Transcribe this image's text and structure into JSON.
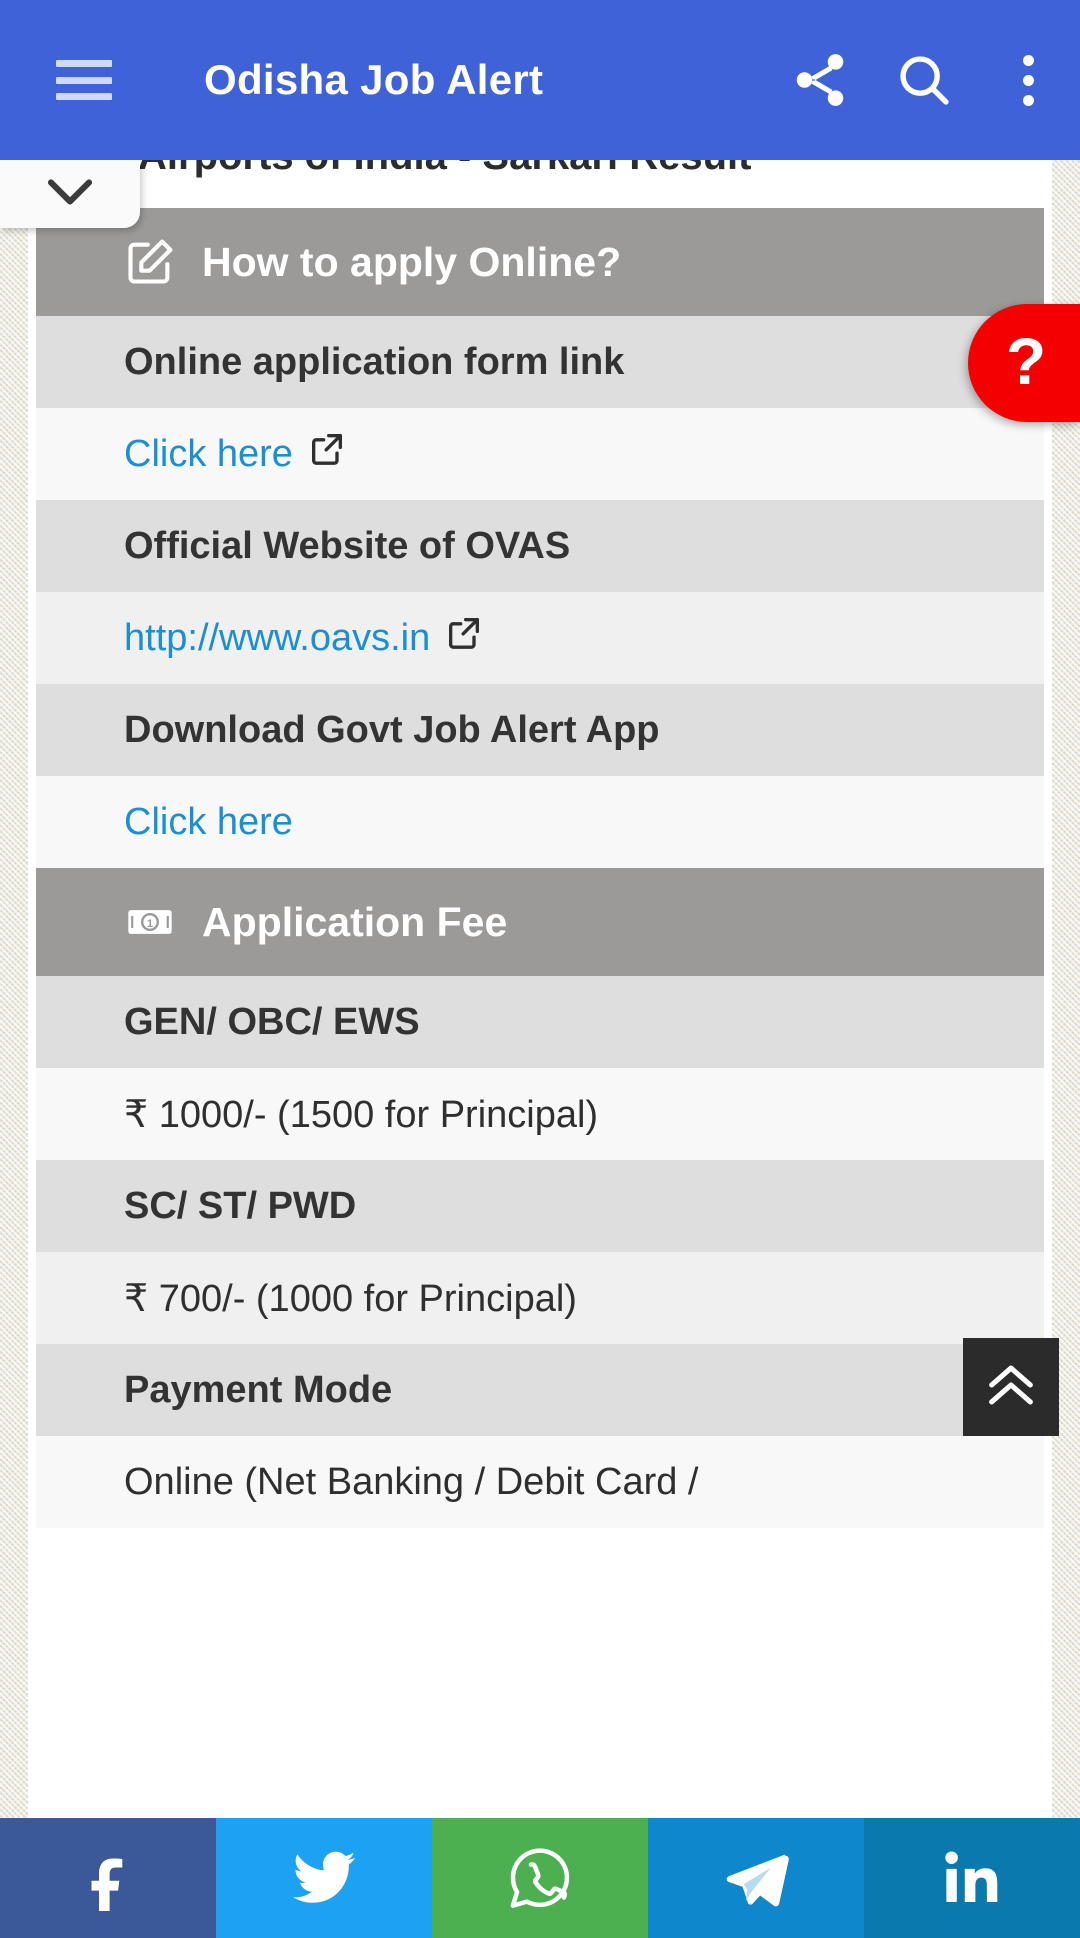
{
  "appbar": {
    "title": "Odisha Job Alert",
    "menu_icon": "hamburger-menu-icon",
    "share_icon": "share-icon",
    "search_icon": "search-icon",
    "overflow_icon": "more-vertical-icon",
    "brand_color": "#3f62d8"
  },
  "overlay": {
    "collapse_icon": "chevron-down-icon",
    "help_label": "?",
    "help_color": "#f50000",
    "scroll_top_icon": "double-chevron-up-icon"
  },
  "clipped_top_text": "Airports of India - Sarkari Result",
  "table": {
    "rows": [
      {
        "kind": "header",
        "icon": "edit-square-icon",
        "text": "How to apply Online?"
      },
      {
        "kind": "label",
        "text": "Online application form link"
      },
      {
        "kind": "link_a",
        "text": "Click here",
        "external": true
      },
      {
        "kind": "label",
        "text": "Official Website of OVAS"
      },
      {
        "kind": "link_b",
        "text": "http://www.oavs.in",
        "external": true
      },
      {
        "kind": "label",
        "text": "Download Govt Job Alert App"
      },
      {
        "kind": "link_a",
        "text": "Click here",
        "external": false
      },
      {
        "kind": "header",
        "icon": "banknote-icon",
        "text": "Application Fee"
      },
      {
        "kind": "label",
        "text": "GEN/ OBC/ EWS"
      },
      {
        "kind": "value_a",
        "text": "₹ 1000/- (1500 for Principal)"
      },
      {
        "kind": "label",
        "text": "SC/ ST/ PWD"
      },
      {
        "kind": "value_b",
        "text": "₹ 700/- (1000 for Principal)"
      },
      {
        "kind": "label",
        "text": "Payment Mode"
      },
      {
        "kind": "value_a",
        "text": "Online (Net Banking / Debit Card /"
      }
    ]
  },
  "social": {
    "items": [
      {
        "name": "facebook",
        "icon": "facebook-icon",
        "color": "#3b5998",
        "label": "Facebook"
      },
      {
        "name": "twitter",
        "icon": "twitter-icon",
        "color": "#1da1f2",
        "label": "Twitter"
      },
      {
        "name": "whatsapp",
        "icon": "whatsapp-icon",
        "color": "#4caf50",
        "label": "WhatsApp"
      },
      {
        "name": "telegram",
        "icon": "telegram-icon",
        "color": "#0e87cc",
        "label": "Telegram"
      },
      {
        "name": "linkedin",
        "icon": "linkedin-icon",
        "color": "#0a79ae",
        "label": "LinkedIn"
      }
    ]
  }
}
